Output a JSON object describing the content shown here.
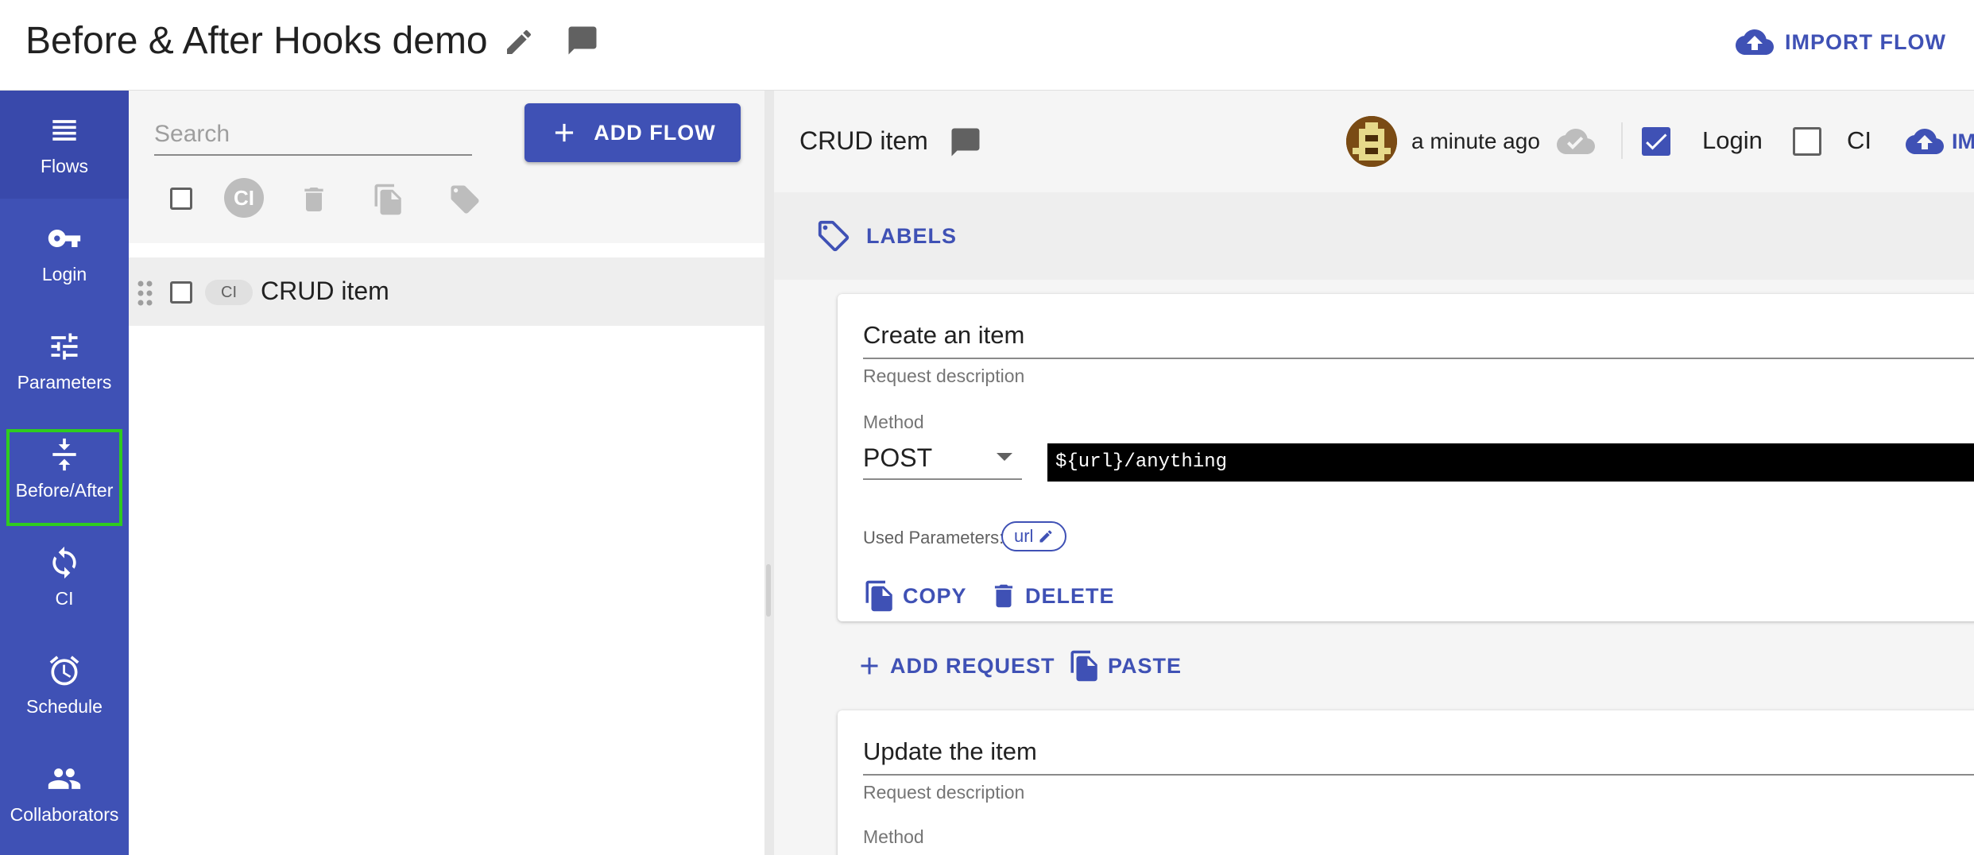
{
  "header": {
    "title": "Before & After Hooks demo",
    "import_label": "IMPORT FLOW"
  },
  "nav": {
    "items": [
      {
        "label": "Flows",
        "icon": "list-icon"
      },
      {
        "label": "Login",
        "icon": "key-icon"
      },
      {
        "label": "Parameters",
        "icon": "tune-icon"
      },
      {
        "label": "Before/After",
        "icon": "vertical-align-center-icon"
      },
      {
        "label": "CI",
        "icon": "sync-icon"
      },
      {
        "label": "Schedule",
        "icon": "alarm-icon"
      },
      {
        "label": "Collaborators",
        "icon": "people-icon"
      }
    ],
    "highlighted": "Before/After"
  },
  "flows_panel": {
    "search_placeholder": "Search",
    "add_flow_label": "ADD FLOW",
    "ci_label": "CI",
    "flows": [
      {
        "name": "CRUD item",
        "badge": "CI"
      }
    ]
  },
  "main": {
    "flow_name": "CRUD item",
    "saved_time": "a minute ago",
    "login_label": "Login",
    "login_checked": true,
    "ci_label": "CI",
    "ci_checked": false,
    "import_partial": "IM",
    "labels_label": "LABELS",
    "requests": [
      {
        "title": "Create an item",
        "description": "Request description",
        "method_label": "Method",
        "method": "POST",
        "url": "${url}/anything",
        "used_params_label": "Used Parameters:",
        "params": [
          "url"
        ],
        "copy_label": "COPY",
        "delete_label": "DELETE"
      },
      {
        "title": "Update the item",
        "description": "Request description",
        "method_label": "Method"
      }
    ],
    "add_request_label": "ADD REQUEST",
    "paste_label": "PASTE"
  },
  "colors": {
    "primary": "#3f51b5",
    "highlight": "#2ecc1f",
    "url_bg": "#000000"
  }
}
